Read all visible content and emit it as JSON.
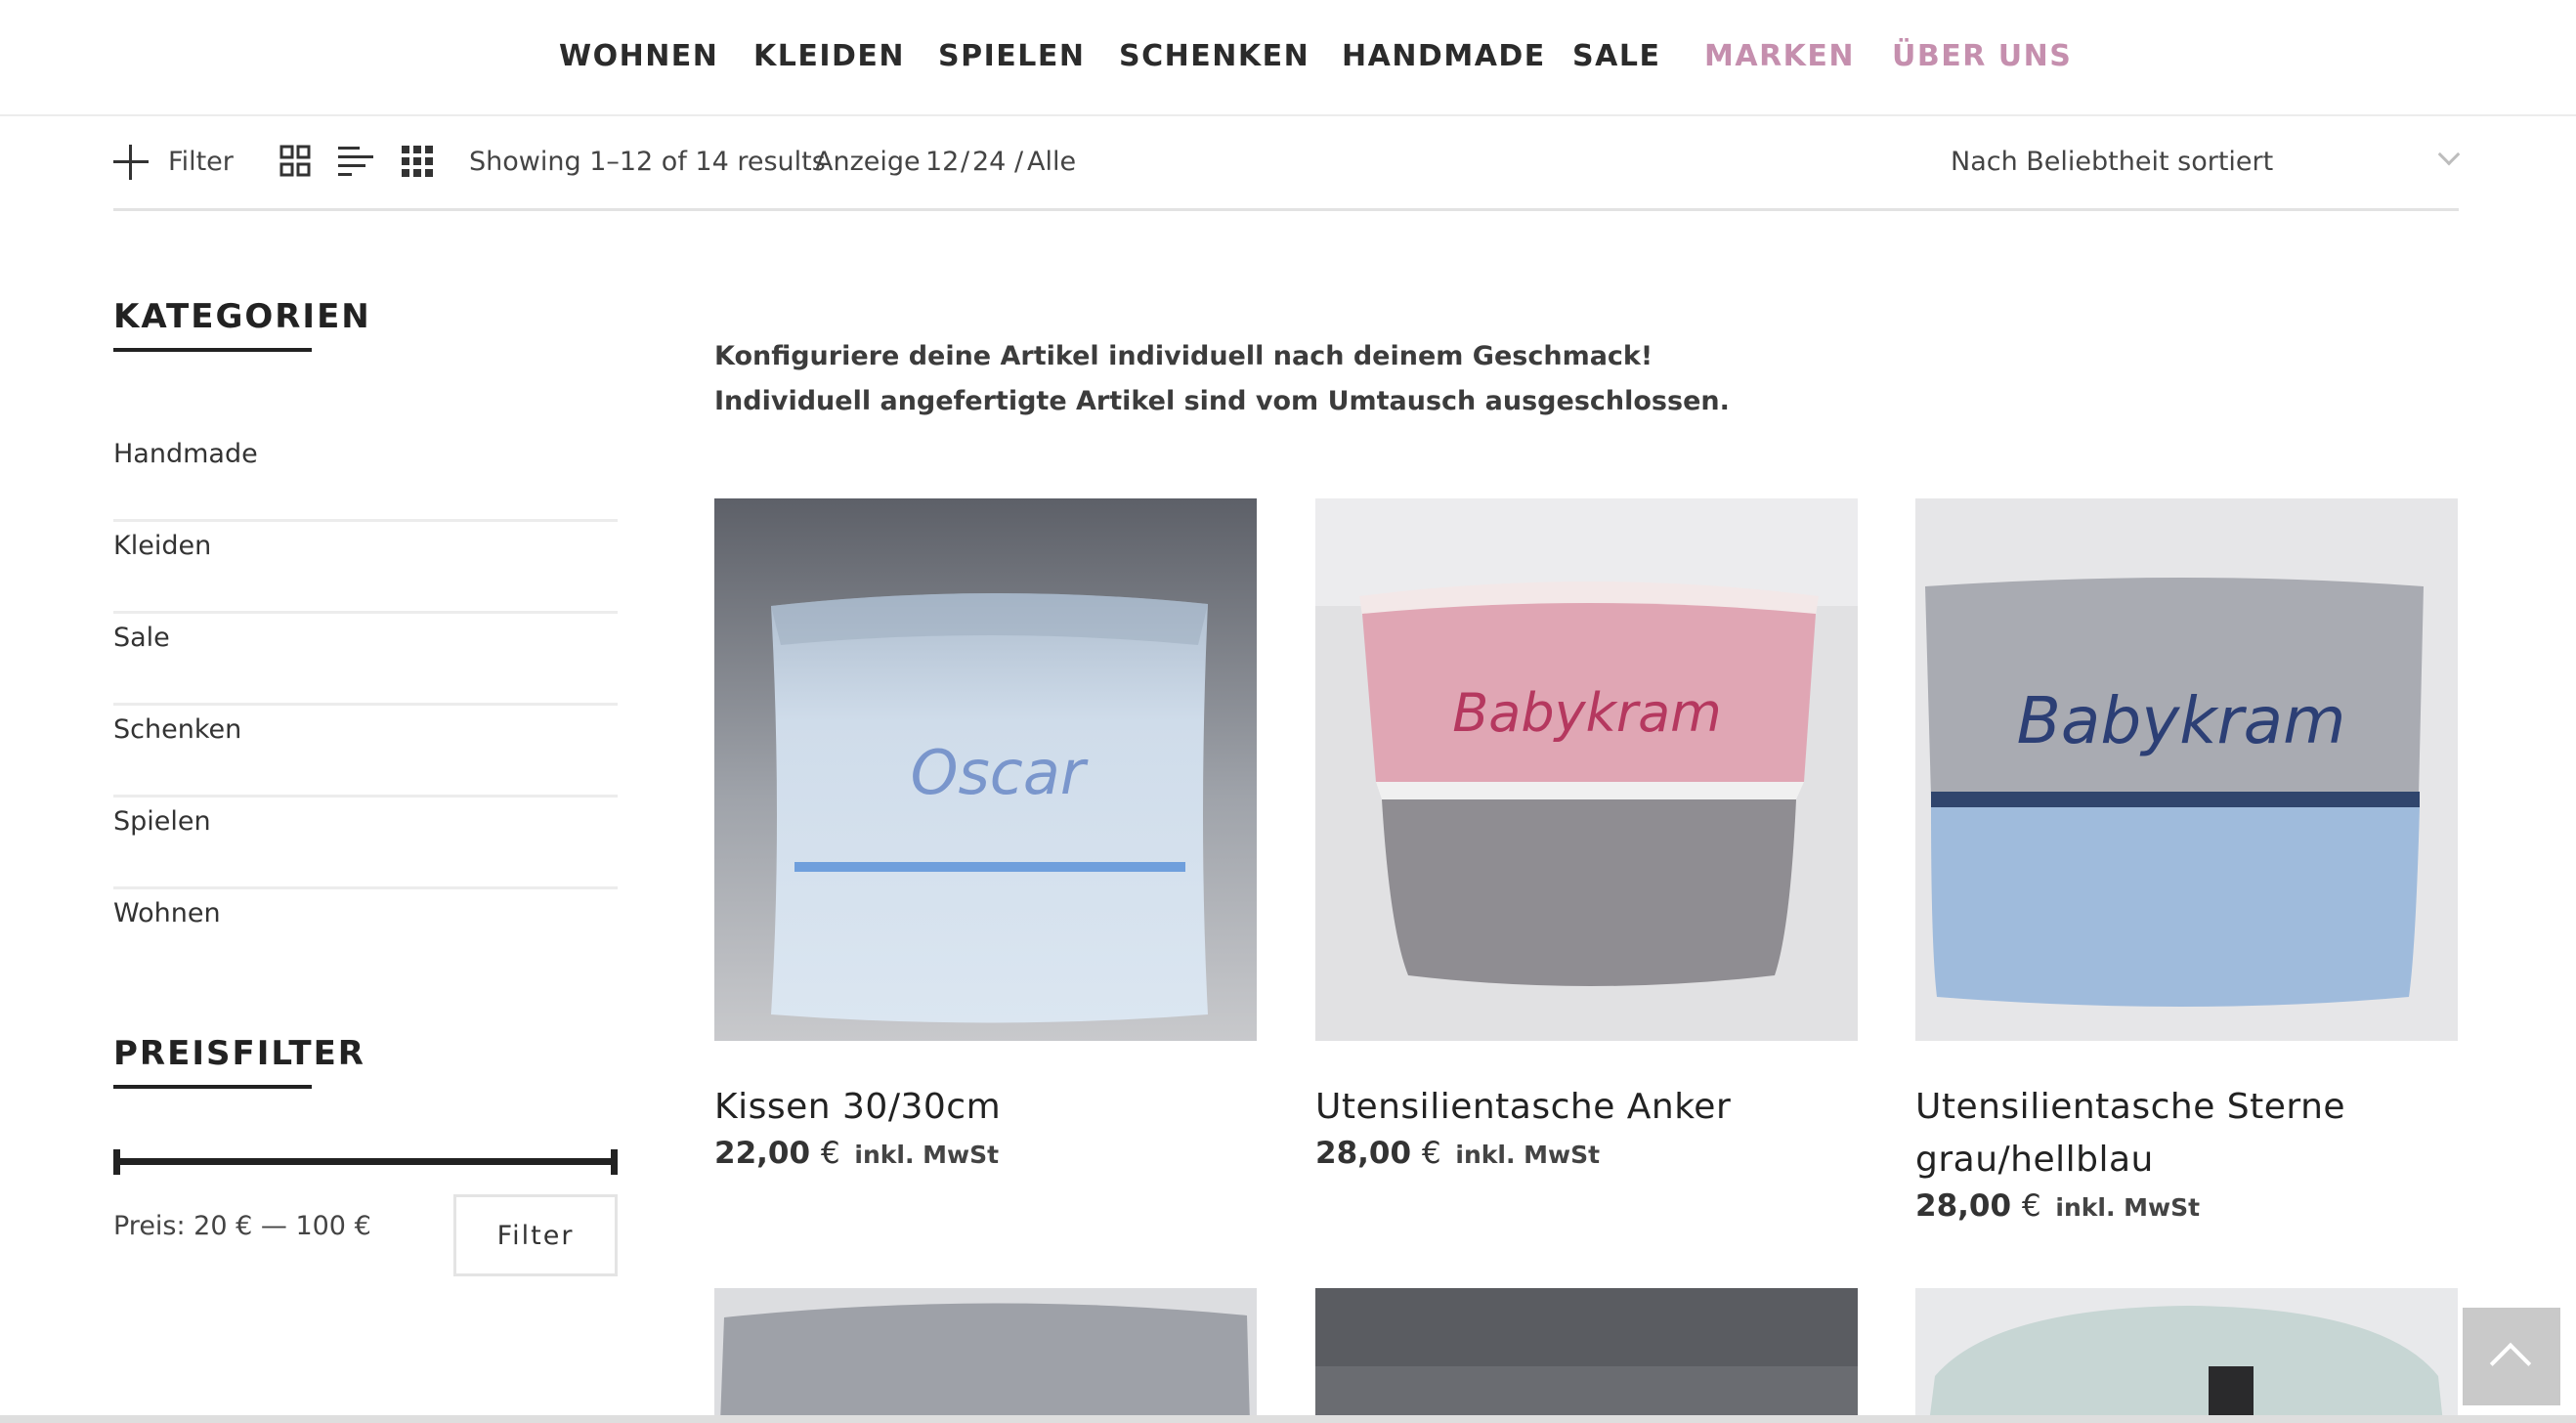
{
  "nav": {
    "items": [
      {
        "label": "WOHNEN"
      },
      {
        "label": "KLEIDEN"
      },
      {
        "label": "SPIELEN"
      },
      {
        "label": "SCHENKEN"
      },
      {
        "label": "HANDMADE"
      },
      {
        "label": "SALE"
      },
      {
        "label": "MARKEN"
      },
      {
        "label": "ÜBER UNS"
      }
    ],
    "accent_color": "#c58fae"
  },
  "toolbar": {
    "filter_label": "Filter",
    "results_text": "Showing 1–12 of 14 results",
    "per_page_label": "Anzeige",
    "per_page_options": [
      "12",
      "24",
      "Alle"
    ],
    "sort_value": "Nach Beliebtheit sortiert",
    "view_icons": [
      "grid-large-icon",
      "list-icon",
      "grid-small-icon"
    ]
  },
  "sidebar": {
    "categories_heading": "KATEGORIEN",
    "categories": [
      "Handmade",
      "Kleiden",
      "Sale",
      "Schenken",
      "Spielen",
      "Wohnen"
    ],
    "price_heading": "PREISFILTER",
    "price_label": "Preis: 20 € — 100 €",
    "price_min": 20,
    "price_max": 100,
    "filter_button": "Filter"
  },
  "intro": {
    "line1": "Konfiguriere deine Artikel individuell nach deinem Geschmack!",
    "line2": "Individuell angefertigte Artikel sind vom Umtausch ausgeschlossen."
  },
  "products": [
    {
      "name": "Kissen 30/30cm",
      "price": "22,00",
      "currency": "€",
      "tax": "inkl. MwSt",
      "embroidery": "Oscar"
    },
    {
      "name": "Utensilientasche Anker",
      "price": "28,00",
      "currency": "€",
      "tax": "inkl. MwSt",
      "embroidery": "Babykram"
    },
    {
      "name": "Utensilientasche Sterne grau/hellblau",
      "price": "28,00",
      "currency": "€",
      "tax": "inkl. MwSt",
      "embroidery": "Babykram"
    }
  ]
}
